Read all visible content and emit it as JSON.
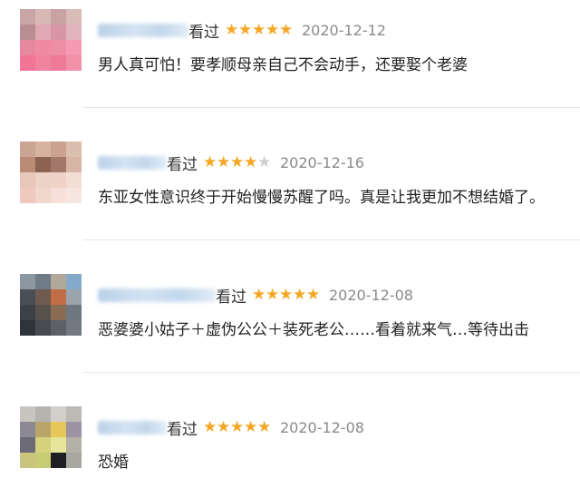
{
  "reviews": [
    {
      "watched_label": "看过",
      "rating": 5,
      "max_rating": 5,
      "date": "2020-12-12",
      "comment": "男人真可怕！要孝顺母亲自己不会动手，还要娶个老婆",
      "avatar_colors": [
        "#c9a5a5",
        "#d8b8b5",
        "#c8a3a2",
        "#d9bcb8",
        "#b98e93",
        "#e0a8b2",
        "#d796a4",
        "#e2b4bd",
        "#e7889f",
        "#f08aa2",
        "#ee8ea5",
        "#f59ab0",
        "#f27595",
        "#f0849f",
        "#ee7a97",
        "#f290a7"
      ]
    },
    {
      "watched_label": "看过",
      "rating": 4,
      "max_rating": 5,
      "date": "2020-12-16",
      "comment": "东亚女性意识终于开始慢慢苏醒了吗。真是让我更加不想结婚了。",
      "avatar_colors": [
        "#caa594",
        "#d6b29f",
        "#cba190",
        "#dbbfae",
        "#b98a74",
        "#8c6251",
        "#a3786a",
        "#d7b5a4",
        "#e6c7b9",
        "#edd2c6",
        "#f0d3c8",
        "#f3ded5",
        "#efc9bd",
        "#f2d7cc",
        "#f6e0d9",
        "#f7e6df"
      ]
    },
    {
      "watched_label": "看过",
      "rating": 5,
      "max_rating": 5,
      "date": "2020-12-08",
      "comment": "恶婆婆小姑子＋虚伪公公＋装死老公……看着就来气…等待出击",
      "avatar_colors": [
        "#8d97a1",
        "#6f7b86",
        "#b2a899",
        "#85a9c9",
        "#4a4f55",
        "#6e5a4e",
        "#c26d45",
        "#9aa4ad",
        "#3c4148",
        "#57524c",
        "#8a6c55",
        "#6e7780",
        "#2f3439",
        "#484c51",
        "#5d6166",
        "#737980"
      ]
    },
    {
      "watched_label": "看过",
      "rating": 5,
      "max_rating": 5,
      "date": "2020-12-08",
      "comment": "恐婚",
      "avatar_colors": [
        "#c8c4bf",
        "#b7b3ae",
        "#d2cec9",
        "#bdb9b4",
        "#8c8894",
        "#b9a56a",
        "#e6c85a",
        "#9b93a3",
        "#6d6a78",
        "#d6d17d",
        "#e7e59a",
        "#b3b0a5",
        "#c9c57e",
        "#c8cc74",
        "#1f1f24",
        "#a9a8a0"
      ]
    }
  ]
}
